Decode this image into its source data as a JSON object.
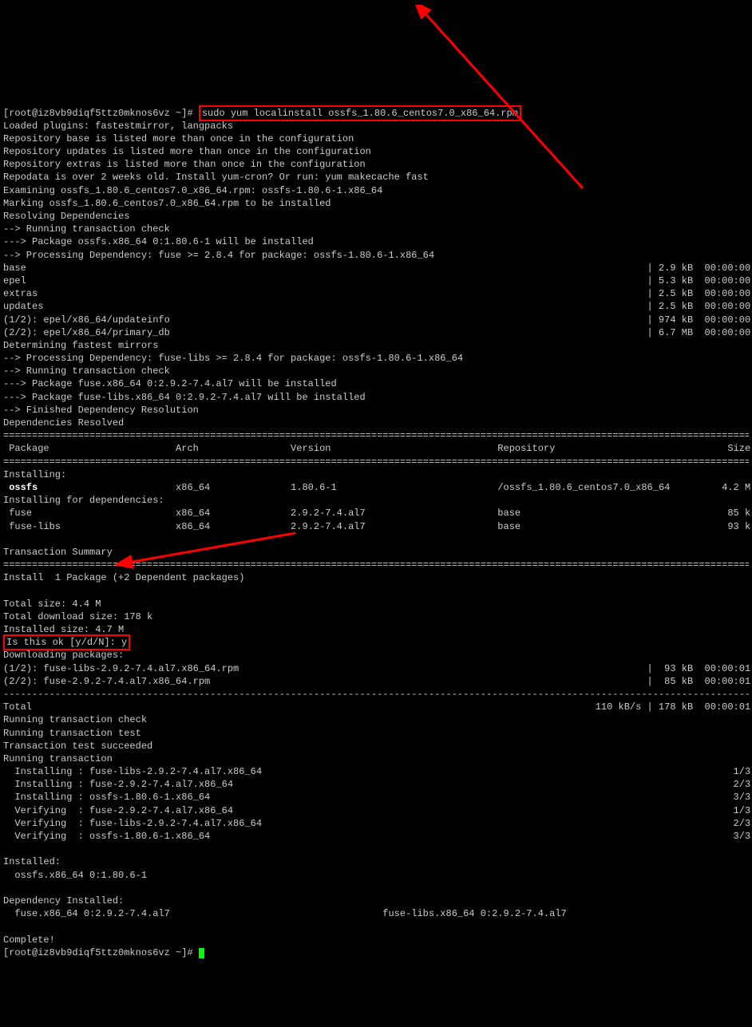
{
  "prompt_prefix": "[root@iz8vb9diqf5ttz0mknos6vz ~]# ",
  "command": "sudo yum localinstall ossfs_1.80.6_centos7.0_x86_64.rpm",
  "prelines": [
    "Loaded plugins: fastestmirror, langpacks",
    "Repository base is listed more than once in the configuration",
    "Repository updates is listed more than once in the configuration",
    "Repository extras is listed more than once in the configuration",
    "Repodata is over 2 weeks old. Install yum-cron? Or run: yum makecache fast",
    "Examining ossfs_1.80.6_centos7.0_x86_64.rpm: ossfs-1.80.6-1.x86_64",
    "Marking ossfs_1.80.6_centos7.0_x86_64.rpm to be installed",
    "Resolving Dependencies",
    "--> Running transaction check",
    "---> Package ossfs.x86_64 0:1.80.6-1 will be installed",
    "--> Processing Dependency: fuse >= 2.8.4 for package: ossfs-1.80.6-1.x86_64"
  ],
  "repos": [
    {
      "name": "base",
      "size": "2.9 kB",
      "time": "00:00:00"
    },
    {
      "name": "epel",
      "size": "5.3 kB",
      "time": "00:00:00"
    },
    {
      "name": "extras",
      "size": "2.5 kB",
      "time": "00:00:00"
    },
    {
      "name": "updates",
      "size": "2.5 kB",
      "time": "00:00:00"
    }
  ],
  "repofiles": [
    {
      "name": "(1/2): epel/x86_64/updateinfo",
      "size": "974 kB",
      "time": "00:00:00"
    },
    {
      "name": "(2/2): epel/x86_64/primary_db",
      "size": "6.7 MB",
      "time": "00:00:00"
    }
  ],
  "postlines": [
    "Determining fastest mirrors",
    "--> Processing Dependency: fuse-libs >= 2.8.4 for package: ossfs-1.80.6-1.x86_64",
    "--> Running transaction check",
    "---> Package fuse.x86_64 0:2.9.2-7.4.al7 will be installed",
    "---> Package fuse-libs.x86_64 0:2.9.2-7.4.al7 will be installed",
    "--> Finished Dependency Resolution",
    "",
    "Dependencies Resolved",
    ""
  ],
  "table_header": {
    "c1": "Package",
    "c2": "Arch",
    "c3": "Version",
    "c4": "Repository",
    "c5": "Size"
  },
  "installing_label": "Installing:",
  "install_row": {
    "c1": "ossfs",
    "c2": "x86_64",
    "c3": "1.80.6-1",
    "c4": "/ossfs_1.80.6_centos7.0_x86_64",
    "c5": "4.2 M"
  },
  "dep_label": "Installing for dependencies:",
  "dep_rows": [
    {
      "c1": "fuse",
      "c2": "x86_64",
      "c3": "2.9.2-7.4.al7",
      "c4": "base",
      "c5": "85 k"
    },
    {
      "c1": "fuse-libs",
      "c2": "x86_64",
      "c3": "2.9.2-7.4.al7",
      "c4": "base",
      "c5": "93 k"
    }
  ],
  "tx_summary_label": "Transaction Summary",
  "install_summary": "Install  1 Package (+2 Dependent packages)",
  "sizes": [
    "Total size: 4.4 M",
    "Total download size: 178 k",
    "Installed size: 4.7 M"
  ],
  "confirm": "Is this ok [y/d/N]: y",
  "downloading": "Downloading packages:",
  "downloads": [
    {
      "name": "(1/2): fuse-libs-2.9.2-7.4.al7.x86_64.rpm",
      "size": " 93 kB",
      "time": "00:00:01"
    },
    {
      "name": "(2/2): fuse-2.9.2-7.4.al7.x86_64.rpm",
      "size": " 85 kB",
      "time": "00:00:01"
    }
  ],
  "total_line": {
    "left": "Total",
    "right": "110 kB/s | 178 kB  00:00:01"
  },
  "txlines": [
    "Running transaction check",
    "Running transaction test",
    "Transaction test succeeded",
    "Running transaction"
  ],
  "progress": [
    {
      "left": "  Installing : fuse-libs-2.9.2-7.4.al7.x86_64",
      "right": "1/3"
    },
    {
      "left": "  Installing : fuse-2.9.2-7.4.al7.x86_64",
      "right": "2/3"
    },
    {
      "left": "  Installing : ossfs-1.80.6-1.x86_64",
      "right": "3/3"
    },
    {
      "left": "  Verifying  : fuse-2.9.2-7.4.al7.x86_64",
      "right": "1/3"
    },
    {
      "left": "  Verifying  : fuse-libs-2.9.2-7.4.al7.x86_64",
      "right": "2/3"
    },
    {
      "left": "  Verifying  : ossfs-1.80.6-1.x86_64",
      "right": "3/3"
    }
  ],
  "installed_label": "Installed:",
  "installed_item": "  ossfs.x86_64 0:1.80.6-1",
  "depinst_label": "Dependency Installed:",
  "depinst_left": "  fuse.x86_64 0:2.9.2-7.4.al7",
  "depinst_right": "fuse-libs.x86_64 0:2.9.2-7.4.al7",
  "complete": "Complete!",
  "prompt2": "[root@iz8vb9diqf5ttz0mknos6vz ~]# "
}
